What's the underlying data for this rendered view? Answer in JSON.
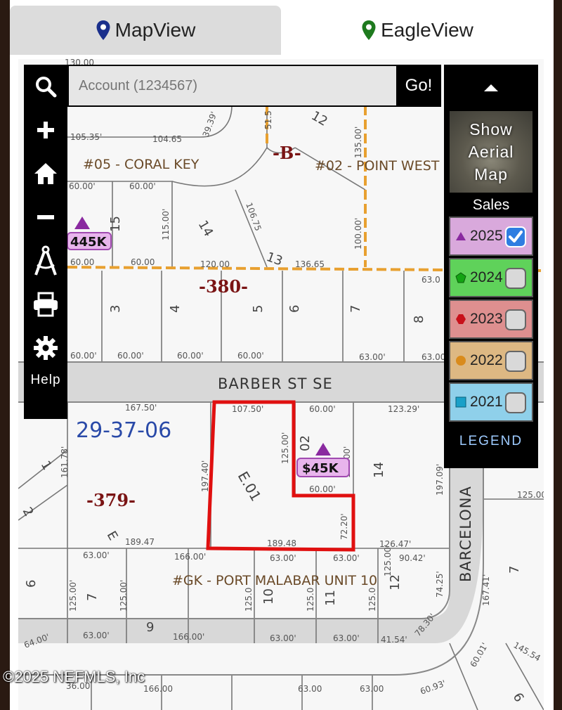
{
  "tabs": {
    "mapview": "MapView",
    "eagleview": "EagleView"
  },
  "colors": {
    "mapview_pin": "#1a2f8c",
    "eagleview_pin": "#1e7a1e",
    "parcel_outline": "#e01010",
    "subdivision_line": "#e8a030",
    "block_label": "#7a1414",
    "section_label": "#2a4aa8"
  },
  "search": {
    "placeholder": "Account (1234567)",
    "go_label": "Go!"
  },
  "toolbar": {
    "icons": [
      "search-icon",
      "zoom-in-icon",
      "home-icon",
      "zoom-out-icon",
      "measure-compass-icon",
      "print-icon",
      "settings-gear-icon"
    ],
    "help_label": "Help"
  },
  "right_panel": {
    "aerial_label": [
      "Show",
      "Aerial",
      "Map"
    ],
    "sales_label": "Sales",
    "years": [
      {
        "year": "2025",
        "marker": "triangle",
        "color": "#d9a9dc",
        "marker_color": "#8a2aa0",
        "checked": true
      },
      {
        "year": "2024",
        "marker": "pentagon",
        "color": "#5fd25a",
        "marker_color": "#13a313",
        "checked": false
      },
      {
        "year": "2023",
        "marker": "hexagon",
        "color": "#de8f8f",
        "marker_color": "#c8101a",
        "checked": false
      },
      {
        "year": "2022",
        "marker": "circle",
        "color": "#ddb883",
        "marker_color": "#d98b1c",
        "checked": false
      },
      {
        "year": "2021",
        "marker": "square",
        "color": "#8fd0ea",
        "marker_color": "#1aa0c8",
        "checked": false
      }
    ],
    "legend_label": "LEGEND"
  },
  "map": {
    "street": "BARBER ST SE",
    "street2": "BARCELONA",
    "section": "29-37-06",
    "blocks": [
      "-380-",
      "-379-",
      "-B-"
    ],
    "subdivisions": [
      "#05 - CORAL KEY",
      "#02 - POINT WEST",
      "#GK - PORT MALABAR UNIT 10"
    ],
    "sales_badges": [
      "445K",
      "$45K"
    ],
    "parcel_label": "E.01",
    "lot_numbers": [
      "12",
      "15",
      "14",
      "13",
      "3",
      "4",
      "5",
      "6",
      "7",
      "8",
      "1",
      "2",
      "E",
      "02",
      "14",
      "6",
      "7",
      "9",
      "10",
      "11",
      "12",
      "7",
      "6"
    ],
    "dims": [
      "130.00",
      "105.35'",
      "104.65",
      "39.39'",
      "51.5",
      "135.00'",
      "60.00'",
      "60.00'",
      "115.00'",
      "106.75",
      "100.00'",
      "60.00",
      "60.00",
      "120.00",
      "136.65",
      "63.0",
      "60.00'",
      "60.00'",
      "60.00'",
      "60.00'",
      "63.00'",
      "63.00",
      "167.50'",
      "107.50'",
      "60.00'",
      "123.29'",
      "161.78'",
      "197.40'",
      "125.00'",
      "125.00'",
      "60.00'",
      "197.09'",
      "72.20'",
      "189.47",
      "189.48",
      "126.47'",
      "125.00",
      "166.00'",
      "63.00'",
      "63.00'",
      "63.00'",
      "90.42'",
      "74.25'",
      "167.41'",
      "125.00'",
      "125.00'",
      "125.0",
      "125.0",
      "125.0",
      "125.00'",
      "64.00'",
      "63.00'",
      "166.00'",
      "63.00'",
      "63.00'",
      "41.54'",
      "78.30'",
      "60.01'",
      "145.54",
      "60.93'",
      "63.00",
      "63.00",
      "166.00",
      "36.00"
    ]
  },
  "copyright": "©2025 NEFMLS, Inc"
}
